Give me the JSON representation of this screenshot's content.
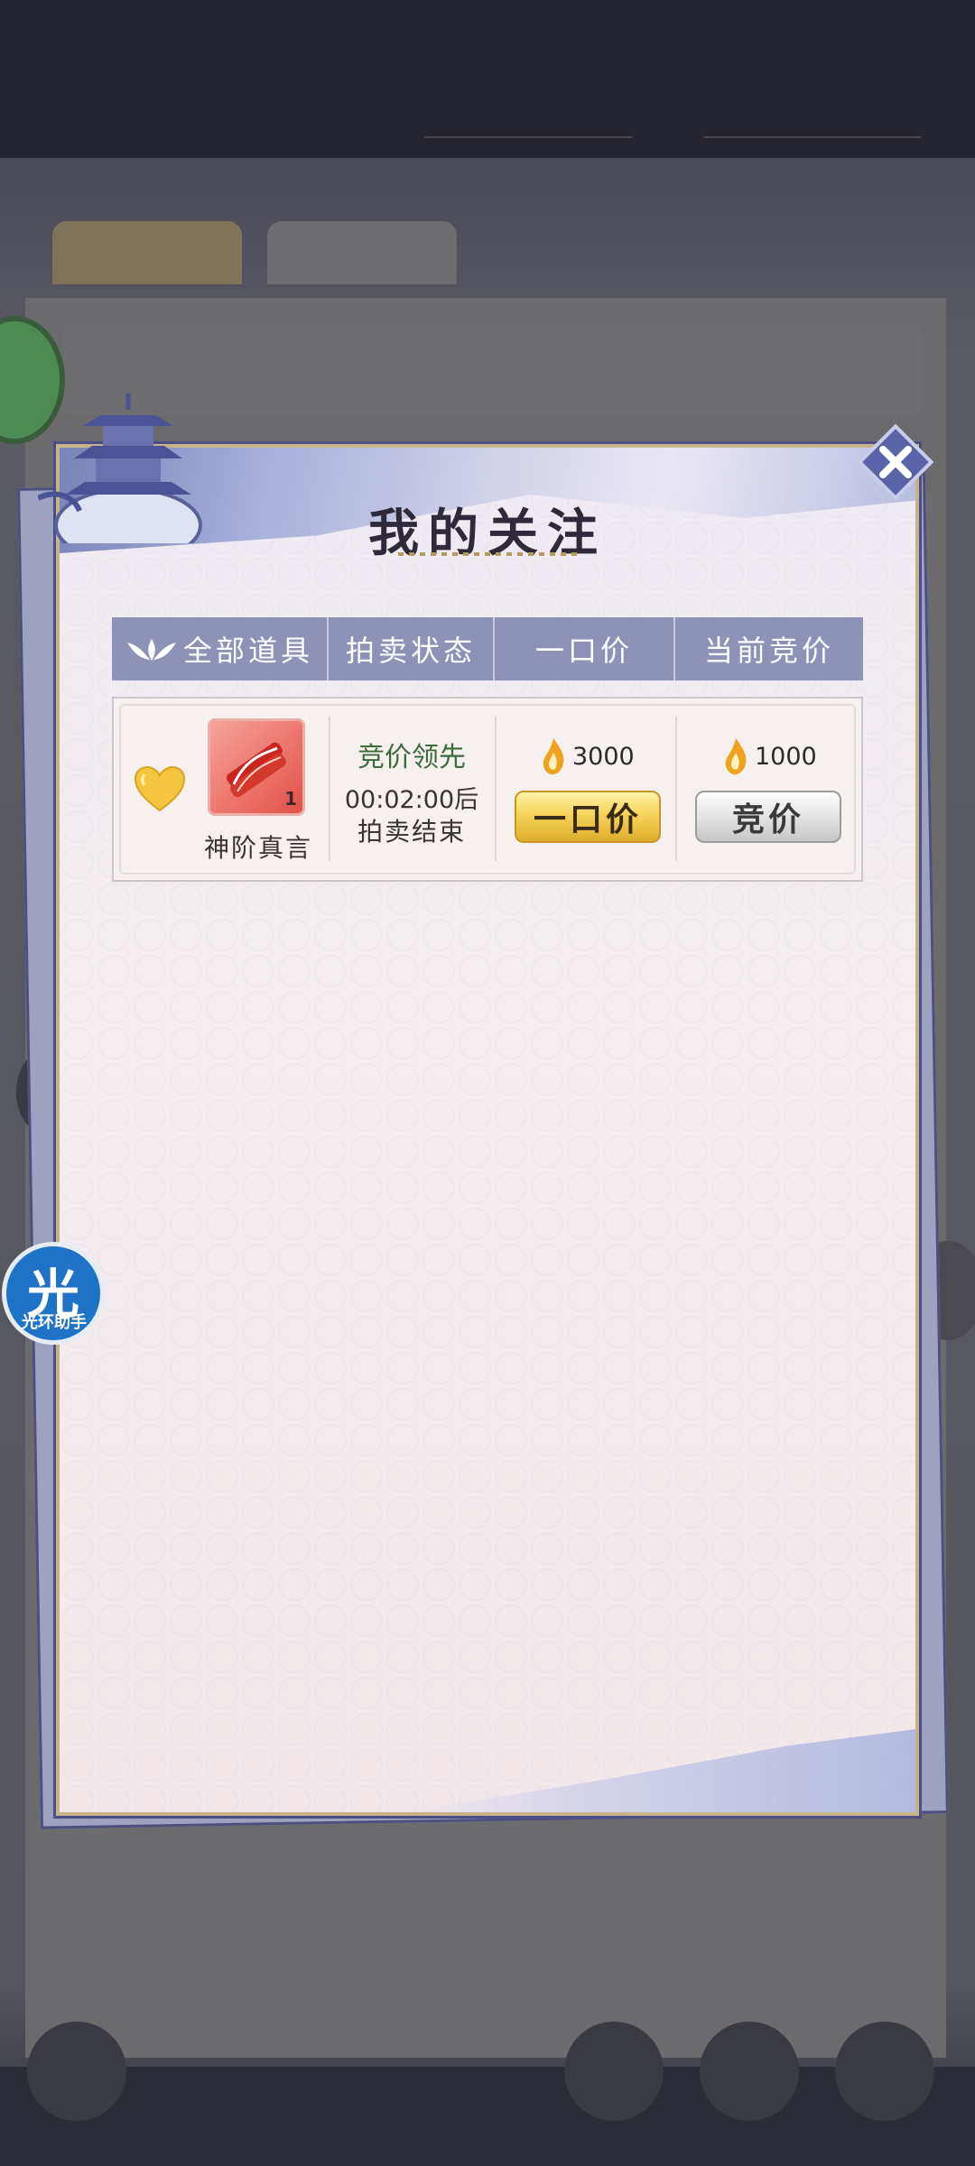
{
  "dialog": {
    "title": "我的关注",
    "headers": [
      "全部道具",
      "拍卖状态",
      "一口价",
      "当前竞价"
    ],
    "items": [
      {
        "name": "神阶真言",
        "icon_count": "1",
        "status_label": "竞价领先",
        "time_left": "00:02:00后",
        "status_suffix": "拍卖结束",
        "buyout_price": "3000",
        "buyout_button": "一口价",
        "bid_price": "1000",
        "bid_button": "竞价",
        "favorited": true
      }
    ]
  },
  "helper": {
    "glyph": "光",
    "label": "光环助手"
  },
  "colors": {
    "header_bg": "#8e92b7",
    "status_lead": "#3f6a3c",
    "gold_button": "#f5d45a",
    "heart": "#f5c542",
    "helper_blue": "#1f73c7"
  },
  "icons": [
    "close-icon",
    "heart-icon",
    "flame-currency-icon",
    "lotus-icon",
    "pagoda-icon"
  ]
}
